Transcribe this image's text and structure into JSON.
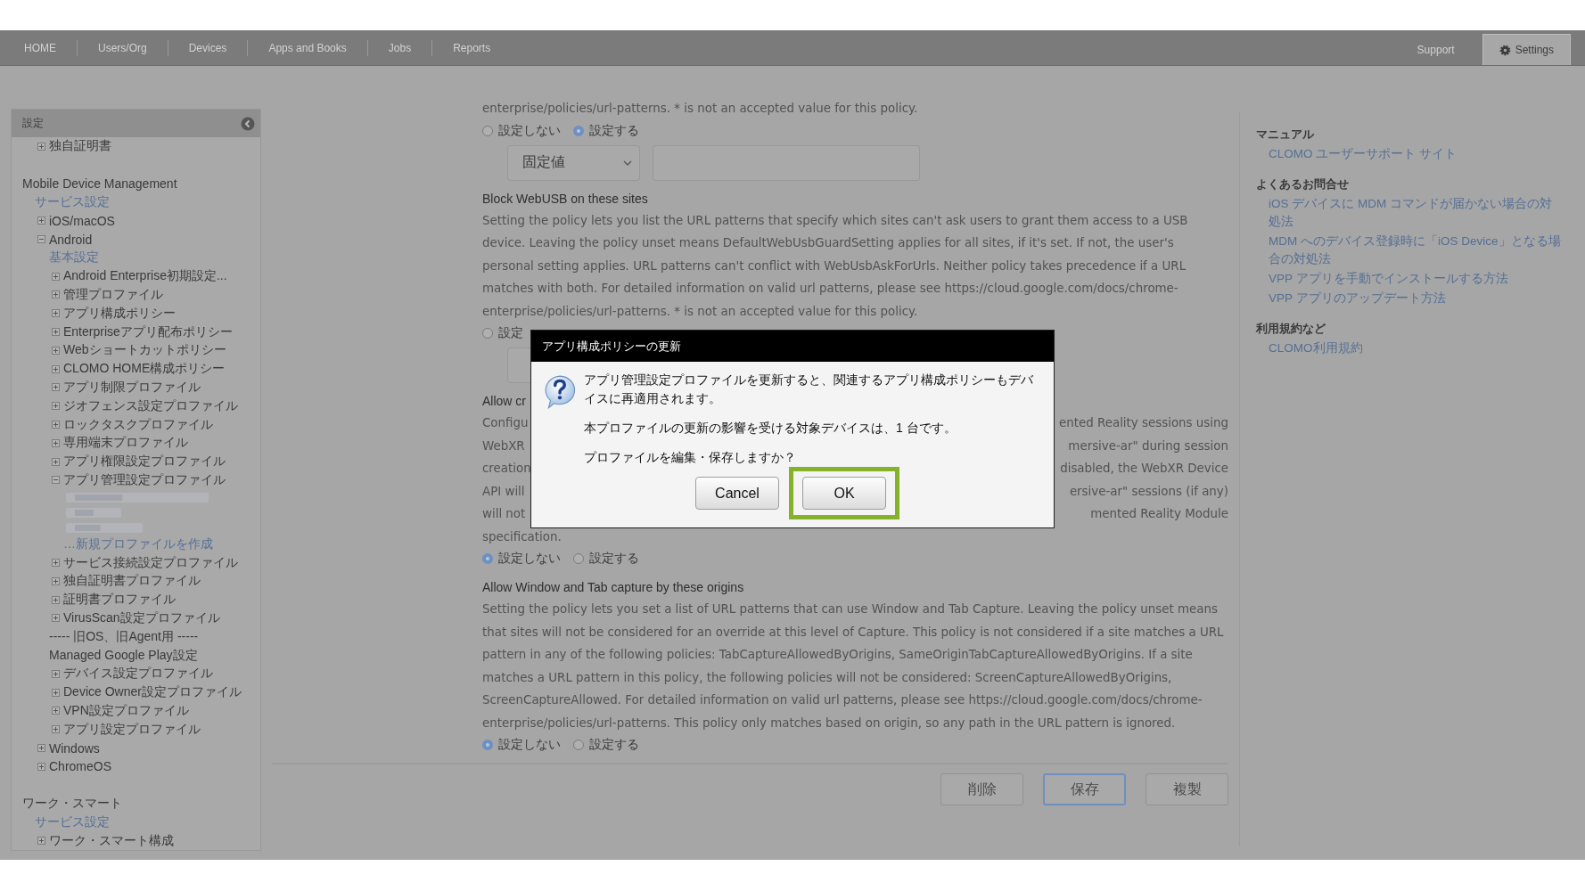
{
  "nav": {
    "tabs": [
      {
        "label": "HOME",
        "selected": false
      },
      {
        "label": "Users/Org",
        "selected": false
      },
      {
        "label": "Devices",
        "selected": false
      },
      {
        "label": "Apps and Books",
        "selected": false
      },
      {
        "label": "Jobs",
        "selected": false
      },
      {
        "label": "Reports",
        "selected": false
      }
    ],
    "right_tabs": [
      {
        "label": "Support",
        "selected": false
      },
      {
        "label": "Settings",
        "selected": true
      }
    ]
  },
  "sidebar": {
    "title": "設定",
    "groups": [
      {
        "items": [
          {
            "kind": "node",
            "label": "独自証明書",
            "expanded": false
          }
        ]
      },
      {
        "title": "Mobile Device Management",
        "items": [
          {
            "kind": "link",
            "label": "サービス設定"
          },
          {
            "kind": "node",
            "label": "iOS/macOS",
            "expanded": false
          },
          {
            "kind": "node",
            "label": "Android",
            "expanded": true,
            "children": [
              {
                "kind": "link",
                "label": "基本設定"
              },
              {
                "kind": "node",
                "label": "Android Enterprise初期設定...",
                "expanded": false
              },
              {
                "kind": "node",
                "label": "管理プロファイル",
                "expanded": false
              },
              {
                "kind": "node",
                "label": "アプリ構成ポリシー",
                "expanded": false
              },
              {
                "kind": "node",
                "label": "Enterpriseアプリ配布ポリシー",
                "expanded": false
              },
              {
                "kind": "node",
                "label": "Webショートカットポリシー",
                "expanded": false
              },
              {
                "kind": "node",
                "label": "CLOMO HOME構成ポリシー",
                "expanded": false
              },
              {
                "kind": "node",
                "label": "アプリ制限プロファイル",
                "expanded": false
              },
              {
                "kind": "node",
                "label": "ジオフェンス設定プロファイル",
                "expanded": false
              },
              {
                "kind": "node",
                "label": "ロックタスクプロファイル",
                "expanded": false
              },
              {
                "kind": "node",
                "label": "専用端末プロファイル",
                "expanded": false
              },
              {
                "kind": "node",
                "label": "アプリ権限設定プロファイル",
                "expanded": false
              },
              {
                "kind": "node",
                "label": "アプリ管理設定プロファイル",
                "expanded": true,
                "children": [
                  {
                    "kind": "blurred"
                  },
                  {
                    "kind": "blurred"
                  },
                  {
                    "kind": "blurred"
                  },
                  {
                    "kind": "link",
                    "label": "…新規プロファイルを作成"
                  }
                ]
              },
              {
                "kind": "node",
                "label": "サービス接続設定プロファイル",
                "expanded": false
              },
              {
                "kind": "node",
                "label": "独自証明書プロファイル",
                "expanded": false
              },
              {
                "kind": "node",
                "label": "証明書プロファイル",
                "expanded": false
              },
              {
                "kind": "node",
                "label": "VirusScan設定プロファイル",
                "expanded": false
              },
              {
                "kind": "text",
                "label": "----- 旧OS、旧Agent用 -----"
              },
              {
                "kind": "text",
                "label": "Managed Google Play設定"
              },
              {
                "kind": "node",
                "label": "デバイス設定プロファイル",
                "expanded": false
              },
              {
                "kind": "node",
                "label": "Device Owner設定プロファイル",
                "expanded": false
              },
              {
                "kind": "node",
                "label": "VPN設定プロファイル",
                "expanded": false
              },
              {
                "kind": "node",
                "label": "アプリ設定プロファイル",
                "expanded": false
              }
            ]
          },
          {
            "kind": "node",
            "label": "Windows",
            "expanded": false
          },
          {
            "kind": "node",
            "label": "ChromeOS",
            "expanded": false
          }
        ]
      },
      {
        "title": "ワーク・スマート",
        "items": [
          {
            "kind": "link",
            "label": "サービス設定"
          },
          {
            "kind": "node",
            "label": "ワーク・スマート構成",
            "expanded": false
          }
        ]
      }
    ]
  },
  "main": {
    "blocks": [
      {
        "kind": "text",
        "text": "enterprise/policies/url-patterns. * is not an accepted value for this policy."
      },
      {
        "kind": "radios",
        "options": [
          {
            "label": "設定しない",
            "selected": false
          },
          {
            "label": "設定する",
            "selected": true
          }
        ]
      },
      {
        "kind": "select_row",
        "value": "固定値"
      },
      {
        "kind": "heading",
        "text": "Block WebUSB on these sites"
      },
      {
        "kind": "text",
        "text": "Setting the policy lets you list the URL patterns that specify which sites can't ask users to grant them access to a USB device. Leaving the policy unset means DefaultWebUsbGuardSetting applies for all sites, if it's set. If not, the user's personal setting applies. URL patterns can't conflict with WebUsbAskForUrls. Neither policy takes precedence if a URL matches with both. For detailed information on valid url patterns, please see https://cloud.google.com/docs/chrome-enterprise/policies/url-patterns. * is not an accepted value for this policy."
      },
      {
        "kind": "radios",
        "options": [
          {
            "label": "設定",
            "selected": false
          }
        ]
      },
      {
        "kind": "select_stub"
      },
      {
        "kind": "heading",
        "text": "Allow cr"
      },
      {
        "kind": "split",
        "left": "Configu",
        "right": "ented Reality sessions using"
      },
      {
        "kind": "split",
        "left": "WebXR",
        "right": "mersive-ar\" during session"
      },
      {
        "kind": "split",
        "left": "creation",
        "right": "disabled, the WebXR Device"
      },
      {
        "kind": "split",
        "left": "API will",
        "right": "ersive-ar\" sessions (if any)"
      },
      {
        "kind": "split",
        "left": "will not",
        "right": "mented Reality Module"
      },
      {
        "kind": "text",
        "text": "specification."
      },
      {
        "kind": "radios",
        "options": [
          {
            "label": "設定しない",
            "selected": true
          },
          {
            "label": "設定する",
            "selected": false
          }
        ]
      },
      {
        "kind": "heading",
        "text": "Allow Window and Tab capture by these origins"
      },
      {
        "kind": "text",
        "text": "Setting the policy lets you set a list of URL patterns that can use Window and Tab Capture. Leaving the policy unset means that sites will not be considered for an override at this level of Capture. This policy is not considered if a site matches a URL pattern in any of the following policies: TabCaptureAllowedByOrigins, SameOriginTabCaptureAllowedByOrigins. If a site matches a URL pattern in this policy, the following policies will not be considered: ScreenCaptureAllowedByOrigins, ScreenCaptureAllowed. For detailed information on valid url patterns, please see https://cloud.google.com/docs/chrome-enterprise/policies/url-patterns. This policy only matches based on origin, so any path in the URL pattern is ignored."
      },
      {
        "kind": "radios",
        "options": [
          {
            "label": "設定しない",
            "selected": true
          },
          {
            "label": "設定する",
            "selected": false
          }
        ]
      }
    ],
    "buttons": [
      {
        "label": "削除",
        "primary": false
      },
      {
        "label": "保存",
        "primary": true
      },
      {
        "label": "複製",
        "primary": false
      }
    ]
  },
  "right_panel": {
    "sections": [
      {
        "title": "マニュアル",
        "links": [
          "CLOMO ユーザーサポート サイト"
        ]
      },
      {
        "title": "よくあるお問合せ",
        "links": [
          "iOS デバイスに MDM コマンドが届かない場合の対処法",
          "MDM へのデバイス登録時に「iOS Device」となる場合の対処法",
          "VPP アプリを手動でインストールする方法",
          "VPP アプリのアップデート方法"
        ]
      },
      {
        "title": "利用規約など",
        "links": [
          "CLOMO利用規約"
        ]
      }
    ]
  },
  "dialog": {
    "title": "アプリ構成ポリシーの更新",
    "paragraphs": [
      "アプリ管理設定プロファイルを更新すると、関連するアプリ構成ポリシーもデバイスに再適用されます。",
      "本プロファイルの更新の影響を受ける対象デバイスは、1 台です。",
      "プロファイルを編集・保存しますか？"
    ],
    "buttons": [
      {
        "label": "Cancel",
        "highlighted": false
      },
      {
        "label": "OK",
        "highlighted": true
      }
    ]
  }
}
